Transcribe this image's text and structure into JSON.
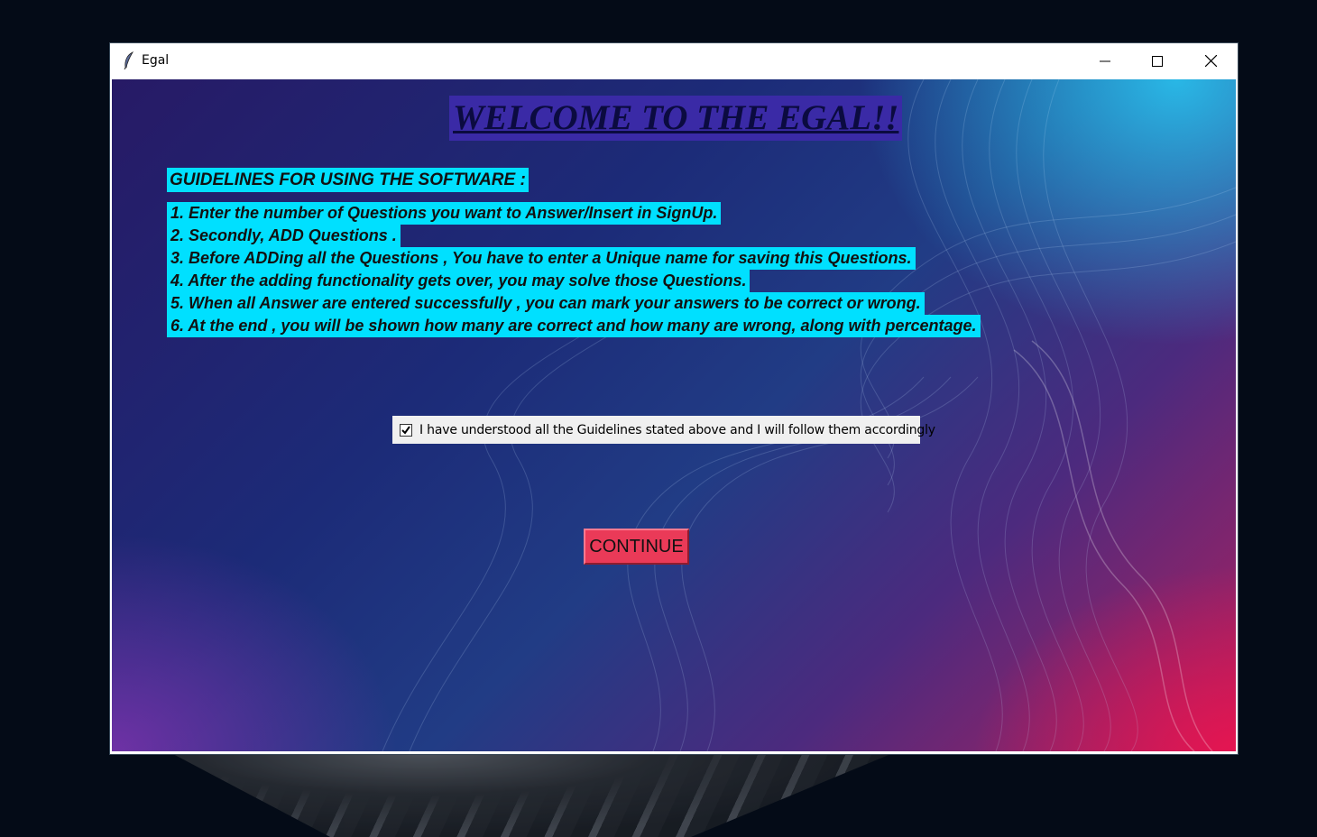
{
  "window": {
    "title": "Egal",
    "controls": {
      "minimize": "minimize-icon",
      "maximize": "maximize-icon",
      "close": "close-icon"
    }
  },
  "content": {
    "welcome": "WELCOME TO THE EGAL!!",
    "guidelines_heading": "GUIDELINES FOR USING THE SOFTWARE :",
    "guidelines": [
      "1. Enter the number of Questions you want to Answer/Insert in SignUp.",
      "2. Secondly, ADD Questions .",
      "3. Before ADDing all the Questions , You have to enter a Unique name for saving this Questions.",
      "4. After the adding functionality gets over, you may solve those Questions.",
      "5. When all Answer are entered successfully , you can mark your answers to be correct or wrong.",
      "6. At the end , you will be shown how many are correct and how many are wrong, along with percentage."
    ],
    "agreement_label": "I have understood all the Guidelines stated above and I will follow them accordingly",
    "agreement_checked": true,
    "continue_label": "CONTINUE"
  },
  "colors": {
    "highlight": "#00e0ff",
    "welcome_bg": "#3a2aa6",
    "continue_bg": "#ea3a58"
  }
}
